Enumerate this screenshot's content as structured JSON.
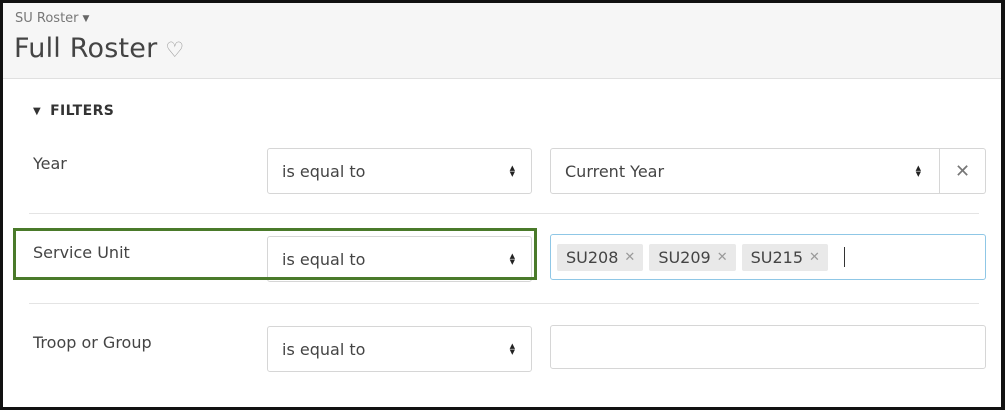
{
  "header": {
    "breadcrumb": "SU Roster",
    "title": "Full Roster",
    "favorite_icon": "heart-outline-icon"
  },
  "filters": {
    "toggle_label": "FILTERS",
    "rows": [
      {
        "label": "Year",
        "operator": "is equal to",
        "value": "Current Year"
      },
      {
        "label": "Service Unit",
        "operator": "is equal to",
        "tags": [
          "SU208",
          "SU209",
          "SU215"
        ]
      },
      {
        "label": "Troop or Group",
        "operator": "is equal to",
        "value": ""
      }
    ]
  },
  "colors": {
    "highlight": "#4a7a2a",
    "focus_border": "#8fc7e6"
  }
}
